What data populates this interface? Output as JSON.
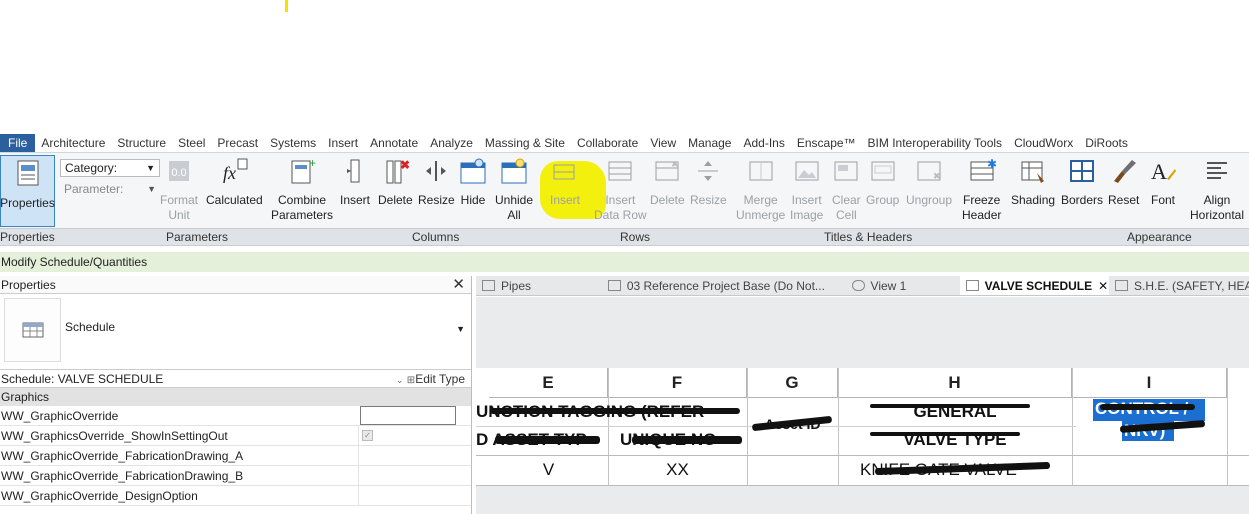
{
  "ribbon_tabs": [
    "File",
    "Architecture",
    "Structure",
    "Steel",
    "Precast",
    "Systems",
    "Insert",
    "Annotate",
    "Analyze",
    "Massing & Site",
    "Collaborate",
    "View",
    "Manage",
    "Add-Ins",
    "Enscape™",
    "BIM Interoperability Tools",
    "CloudWorx",
    "DiRoots"
  ],
  "ribbon": {
    "properties": "Properties",
    "category_label": "Category:",
    "parameter_label": "Parameter:",
    "format_unit": [
      "Format",
      "Unit"
    ],
    "calculated": "Calculated",
    "combine_parameters": [
      "Combine",
      "Parameters"
    ],
    "insert": "Insert",
    "delete": "Delete",
    "resize": "Resize",
    "hide": "Hide",
    "unhide_all": [
      "Unhide",
      "All"
    ],
    "rows_insert": "Insert",
    "insert_data_row": [
      "Insert",
      "Data Row"
    ],
    "rows_delete": "Delete",
    "rows_resize": "Resize",
    "merge_unmerge": [
      "Merge",
      "Unmerge"
    ],
    "insert_image": [
      "Insert",
      "Image"
    ],
    "clear_cell": [
      "Clear",
      "Cell"
    ],
    "group": "Group",
    "ungroup": "Ungroup",
    "freeze_header": [
      "Freeze",
      "Header"
    ],
    "shading": "Shading",
    "borders": "Borders",
    "reset": "Reset",
    "font": "Font",
    "align_horizontal": [
      "Align",
      "Horizontal"
    ]
  },
  "panels": {
    "properties": "Properties",
    "parameters": "Parameters",
    "columns": "Columns",
    "rows": "Rows",
    "titles_headers": "Titles & Headers",
    "appearance": "Appearance"
  },
  "context_bar": "Modify Schedule/Quantities",
  "properties_palette": {
    "title": "Properties",
    "type_name": "Schedule",
    "selector": "Schedule: VALVE SCHEDULE",
    "edit_type": "Edit Type",
    "group": "Graphics",
    "rows": [
      "WW_GraphicOverride",
      "WW_GraphicsOverride_ShowInSettingOut",
      "WW_GraphicOverride_FabricationDrawing_A",
      "WW_GraphicOverride_FabricationDrawing_B",
      "WW_GraphicOverride_DesignOption"
    ]
  },
  "view_tabs": [
    {
      "label": "Pipes",
      "active": false
    },
    {
      "label": "03 Reference Project Base (Do Not...",
      "active": false
    },
    {
      "label": "View 1",
      "active": false
    },
    {
      "label": "VALVE SCHEDULE",
      "active": true
    },
    {
      "label": "S.H.E. (SAFETY, HEA",
      "active": false
    }
  ],
  "schedule": {
    "columns": [
      "E",
      "F",
      "G",
      "H",
      "I"
    ],
    "header_row1": [
      "UNCTION TAGGING (REFER",
      "",
      "Asset ID",
      "GENERAL",
      "CONTROL /"
    ],
    "header_row2": [
      "D  ASSET TYP",
      "UNIQUE NO",
      "",
      "VALVE TYPE",
      "NRV)"
    ],
    "data_row": [
      "V",
      "XX",
      "",
      "KNIFE GATE VALVE",
      ""
    ]
  },
  "colors": {
    "file_tab": "#2c5f9e",
    "highlight_yellow": "#f3ef00",
    "selection_blue": "#1a6fd1",
    "context_green": "#e4f0da"
  }
}
